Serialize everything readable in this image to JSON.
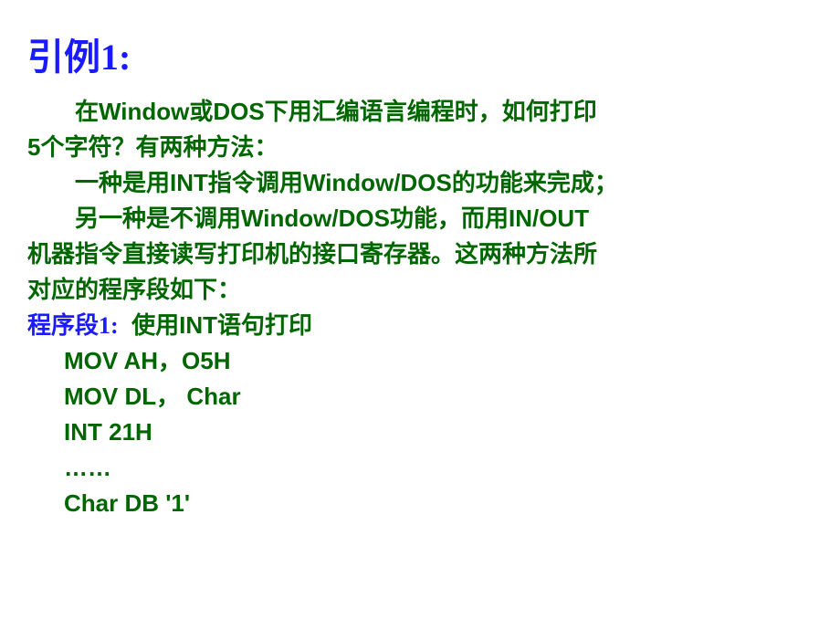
{
  "title": "引例1:",
  "para1_line1": "在Window或DOS下用汇编语言编程时，如何打印",
  "para1_line2": "5个字符？有两种方法：",
  "para2_line1": "一种是用INT指令调用Window/DOS的功能来完成；",
  "para3_line1": "另一种是不调用Window/DOS功能，而用IN/OUT",
  "para3_line2": "机器指令直接读写打印机的接口寄存器。这两种方法所",
  "para3_line3": "对应的程序段如下：",
  "section1_label": "程序段1:",
  "section1_desc": "使用INT语句打印",
  "code": {
    "line1": "MOV   AH，O5H",
    "line2": "MOV   DL， Char",
    "line3": "INT      21H",
    "line4": "……",
    "line5": "Char    DB '1'"
  }
}
